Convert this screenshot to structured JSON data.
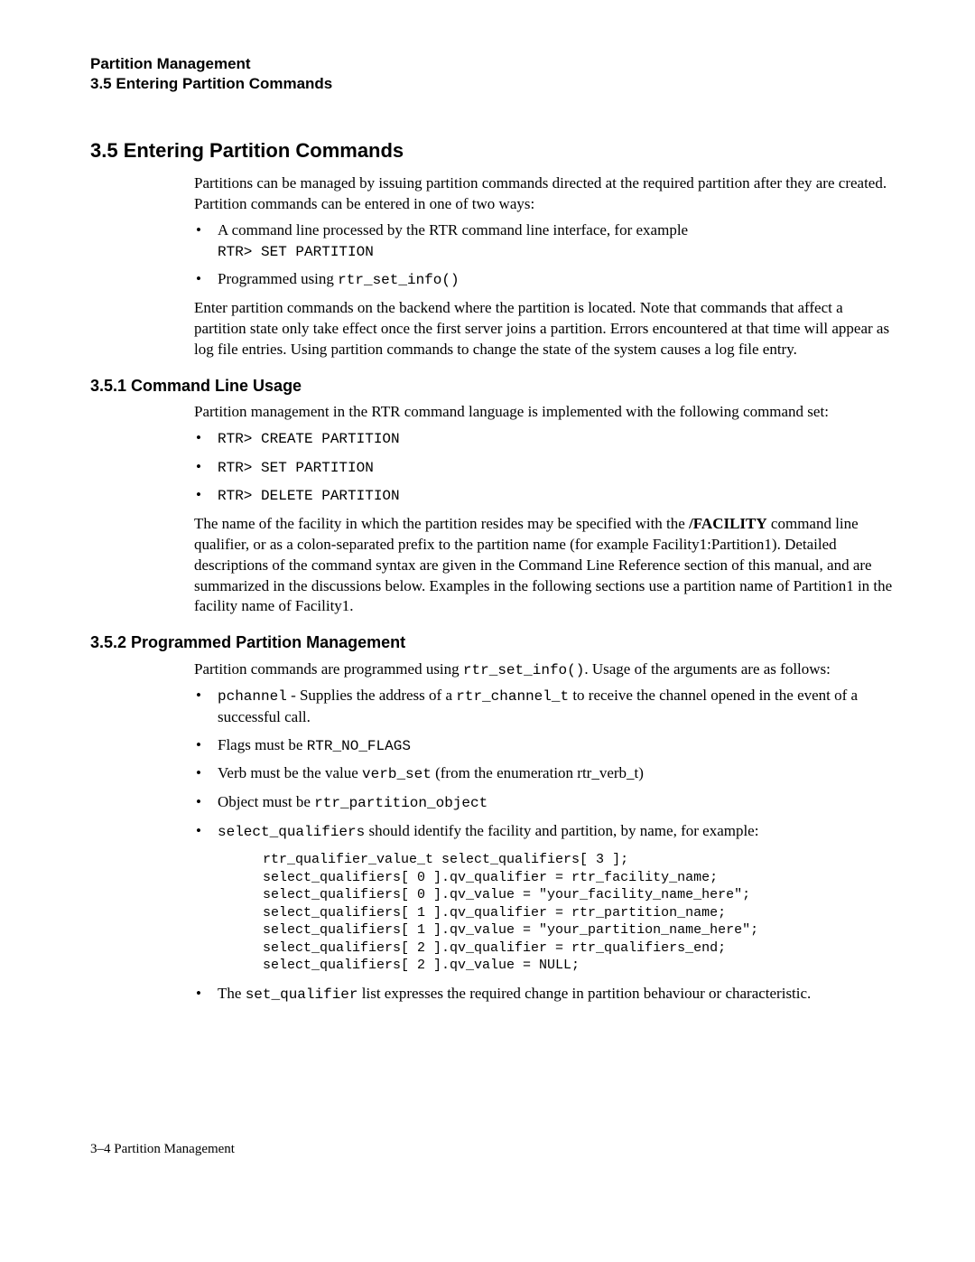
{
  "header": {
    "line1": "Partition Management",
    "line2": "3.5 Entering Partition Commands"
  },
  "section35": {
    "title": "3.5 Entering Partition Commands",
    "intro": "Partitions can be managed by issuing partition commands directed at the required partition after they are created. Partition commands can be entered in one of two ways:",
    "b1_a": "A command line processed by the RTR command line interface, for example",
    "b1_code": "RTR> SET PARTITION",
    "b2_a": "Programmed using ",
    "b2_code": "rtr_set_info()",
    "after": "Enter partition commands on the backend where the partition is located. Note that commands that affect a partition state only take effect once the first server joins a partition. Errors encountered at that time will appear as log file entries. Using partition commands to change the state of the system causes a log file entry."
  },
  "section351": {
    "title": "3.5.1 Command Line Usage",
    "intro": "Partition management in the RTR command language is implemented with the following command set:",
    "cmd1": "RTR> CREATE PARTITION",
    "cmd2": "RTR> SET PARTITION",
    "cmd3": "RTR> DELETE PARTITION",
    "p2a": "The name of the facility in which the partition resides may be specified with the ",
    "p2b": "/FACILITY",
    "p2c": " command line qualifier, or as a colon-separated prefix to the partition name (for example Facility1:Partition1). Detailed descriptions of the command syntax are given in the Command Line Reference section of this manual, and are summarized in the discussions below. Examples in the following sections use a partition name of Partition1 in the facility name of Facility1."
  },
  "section352": {
    "title": "3.5.2 Programmed Partition Management",
    "intro_a": "Partition commands are programmed using ",
    "intro_code": "rtr_set_info()",
    "intro_b": ". Usage of the arguments are as follows:",
    "b1_code1": "pchannel",
    "b1_a": " - Supplies the address of a ",
    "b1_code2": "rtr_channel_t",
    "b1_b": " to receive the channel opened in the event of a successful call.",
    "b2_a": "Flags must be ",
    "b2_code": "RTR_NO_FLAGS",
    "b3_a": "Verb must be the value ",
    "b3_code": "verb_set",
    "b3_b": " (from the enumeration rtr_verb_t)",
    "b4_a": "Object must be ",
    "b4_code": "rtr_partition_object",
    "b5_code": "select_qualifiers",
    "b5_a": " should identify the facility and partition, by name, for example:",
    "code_block": "rtr_qualifier_value_t select_qualifiers[ 3 ];\nselect_qualifiers[ 0 ].qv_qualifier = rtr_facility_name;\nselect_qualifiers[ 0 ].qv_value = \"your_facility_name_here\";\nselect_qualifiers[ 1 ].qv_qualifier = rtr_partition_name;\nselect_qualifiers[ 1 ].qv_value = \"your_partition_name_here\";\nselect_qualifiers[ 2 ].qv_qualifier = rtr_qualifiers_end;\nselect_qualifiers[ 2 ].qv_value = NULL;",
    "b6_a": "The ",
    "b6_code": "set_qualifier",
    "b6_b": " list expresses the required change in partition behaviour or characteristic."
  },
  "footer": {
    "pagenum": "3–4",
    "chapter": " Partition Management"
  }
}
